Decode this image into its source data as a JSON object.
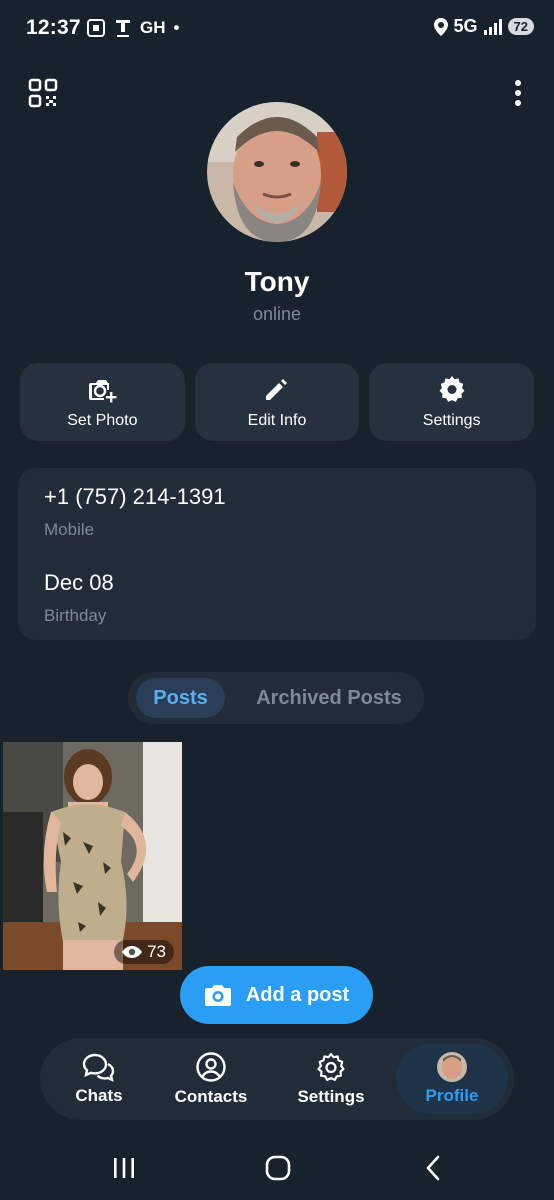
{
  "status_bar": {
    "time": "12:37",
    "left_icons": [
      "screenshot-icon",
      "t-play-icon"
    ],
    "carrier_text": "GH",
    "dot": "•",
    "network": "5G",
    "battery": "72"
  },
  "profile": {
    "name": "Tony",
    "status": "online"
  },
  "actions": [
    {
      "label": "Set Photo",
      "icon": "camera-add-icon"
    },
    {
      "label": "Edit Info",
      "icon": "pencil-icon"
    },
    {
      "label": "Settings",
      "icon": "gear-icon"
    }
  ],
  "info": {
    "phone": "+1 (757) 214-1391",
    "phone_label": "Mobile",
    "birthday": "Dec 08",
    "birthday_label": "Birthday"
  },
  "tabs": {
    "posts": "Posts",
    "archived": "Archived Posts",
    "active": "posts"
  },
  "post": {
    "views": "73"
  },
  "add_post": {
    "label": "Add a post"
  },
  "bottom_nav": [
    {
      "label": "Chats",
      "icon": "chat-bubbles-icon"
    },
    {
      "label": "Contacts",
      "icon": "person-circle-icon"
    },
    {
      "label": "Settings",
      "icon": "gear-icon"
    },
    {
      "label": "Profile",
      "icon": "avatar",
      "active": true
    }
  ],
  "colors": {
    "background": "#18222d",
    "card": "#212c38",
    "button": "#25313e",
    "accent": "#2a9df4",
    "muted": "#7b8a99"
  }
}
